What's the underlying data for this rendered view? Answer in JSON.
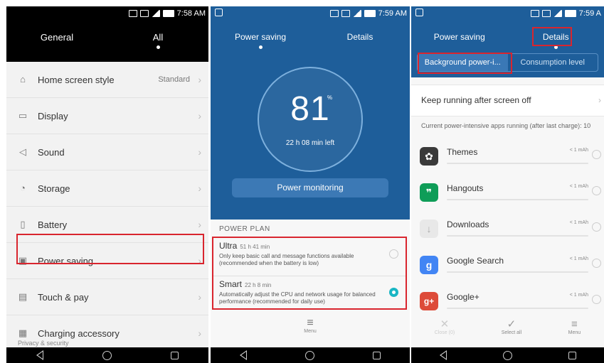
{
  "screen1": {
    "status_time": "7:58 AM",
    "tabs": [
      "General",
      "All"
    ],
    "items": [
      {
        "label": "Home screen style",
        "value": "Standard",
        "icon": "home-icon"
      },
      {
        "label": "Display",
        "value": "",
        "icon": "display-icon"
      },
      {
        "label": "Sound",
        "value": "",
        "icon": "sound-icon"
      },
      {
        "label": "Storage",
        "value": "",
        "icon": "storage-icon"
      },
      {
        "label": "Battery",
        "value": "",
        "icon": "battery-icon"
      },
      {
        "label": "Power saving",
        "value": "",
        "icon": "power-saving-icon"
      },
      {
        "label": "Touch & pay",
        "value": "",
        "icon": "touch-pay-icon"
      },
      {
        "label": "Charging accessory",
        "value": "",
        "icon": "charging-icon"
      }
    ],
    "partial_item": "Privacy & security"
  },
  "screen2": {
    "status_time": "7:59 AM",
    "tabs": [
      "Power saving",
      "Details"
    ],
    "battery_percent": "81",
    "percent_sign": "%",
    "time_left": "22 h 08 min left",
    "power_monitoring": "Power monitoring",
    "plan_title": "POWER PLAN",
    "plans": [
      {
        "name": "Ultra",
        "duration": "51 h 41 min",
        "desc": "Only keep basic call and message functions available (recommended when the battery is low)",
        "selected": false
      },
      {
        "name": "Smart",
        "duration": "22 h 8 min",
        "desc": "Automatically adjust the CPU and network usage for balanced performance (recommended for daily use)",
        "selected": true
      }
    ],
    "menu_label": "Menu"
  },
  "screen3": {
    "status_time": "7:59 A",
    "tabs": [
      "Power saving",
      "Details"
    ],
    "segments": [
      "Background power-i...",
      "Consumption level"
    ],
    "keep_running": "Keep running after screen off",
    "apps_header": "Current power-intensive apps running (after last charge): 10",
    "apps": [
      {
        "name": "Themes",
        "usage": "< 1 mAh",
        "color": "#3a3a3a",
        "glyph": "✿"
      },
      {
        "name": "Hangouts",
        "usage": "< 1 mAh",
        "color": "#0f9d58",
        "glyph": "❞"
      },
      {
        "name": "Downloads",
        "usage": "< 1 mAh",
        "color": "#e8e8e8",
        "glyph": "↓"
      },
      {
        "name": "Google Search",
        "usage": "< 1 mAh",
        "color": "#4285f4",
        "glyph": "g"
      },
      {
        "name": "Google+",
        "usage": "< 1 mAh",
        "color": "#dd4b39",
        "glyph": "g+"
      }
    ],
    "bottom": [
      {
        "label": "Close (0)",
        "glyph": "✕",
        "disabled": true
      },
      {
        "label": "Select all",
        "glyph": "✓",
        "disabled": false
      },
      {
        "label": "Menu",
        "glyph": "≡",
        "disabled": false
      }
    ]
  },
  "accent_colors": {
    "header_blue": "#1e5e9a",
    "highlight_red": "#d9252e",
    "radio_teal": "#19b6c4"
  }
}
